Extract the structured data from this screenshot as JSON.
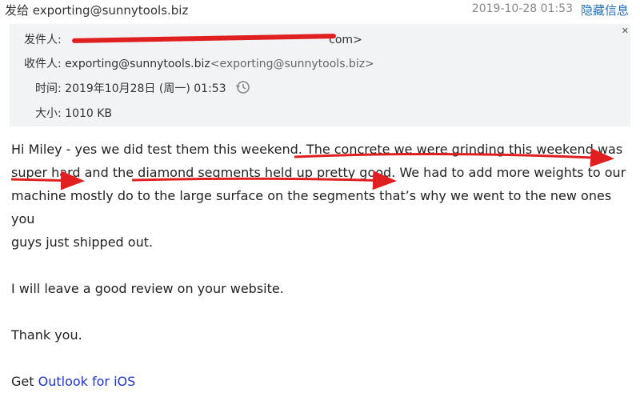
{
  "top": {
    "to_prefix": "发给",
    "to_address": "exporting@sunnytools.biz",
    "date": "2019-10-28 01:53",
    "hide_info": "隐藏信息"
  },
  "header": {
    "from_label": "发件人:",
    "from_value_visible": "com>",
    "to_label": "收件人:",
    "to_address": "exporting@sunnytools.biz",
    "to_address_bracket": "<exporting@sunnytools.biz>",
    "time_label": "时间:",
    "time_value": "2019年10月28日 (周一) 01:53",
    "size_label": "大小:",
    "size_value": "1010 KB"
  },
  "body": {
    "line1": "Hi Miley - yes we did test them this weekend. The concrete we were grinding this weekend was",
    "line2": "super hard and the diamond segments held up pretty good. We had to add more weights to our",
    "line3": "machine mostly do to the large surface on the segments that’s why we went to the new ones you",
    "line4": "guys just shipped out.",
    "line5": "I will leave a good review on your website.",
    "line6": "Thank you.",
    "signature_prefix": "Get ",
    "signature_link": "Outlook for iOS"
  },
  "colors": {
    "annotation_red": "#e02020",
    "link_blue": "#2035c8",
    "header_bg": "#f1f3f4"
  }
}
